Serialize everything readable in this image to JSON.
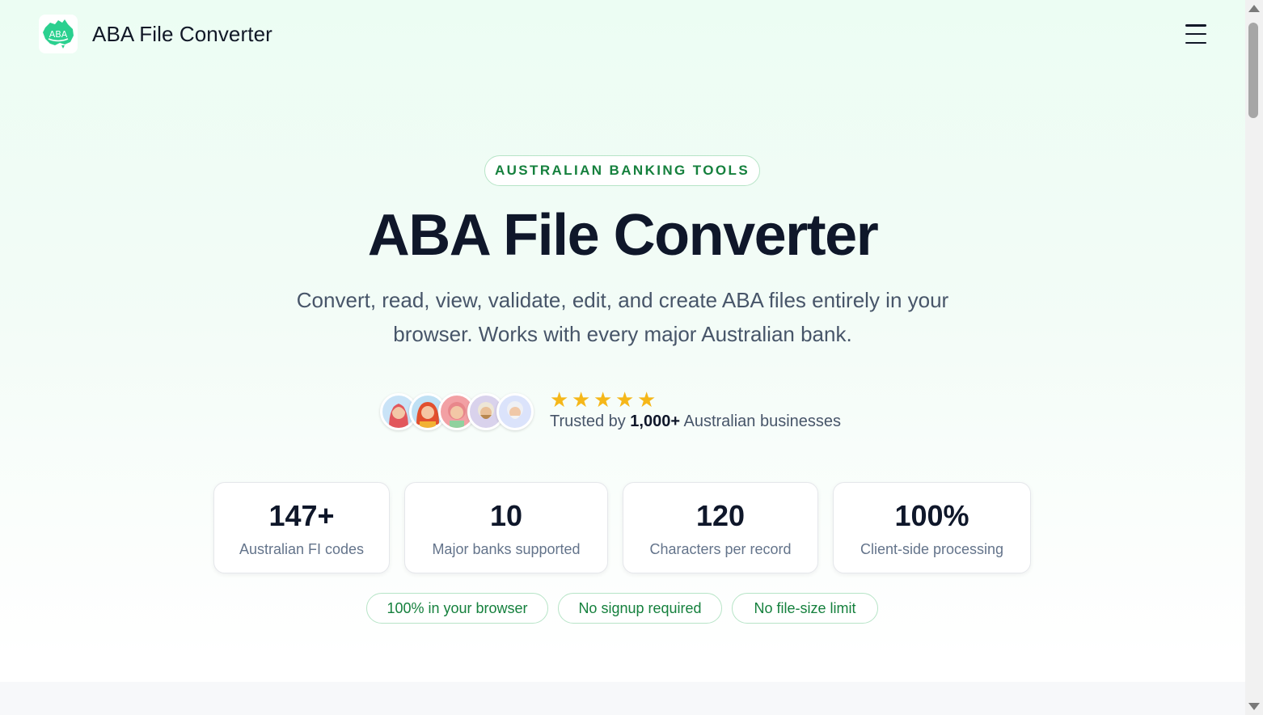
{
  "header": {
    "logo_text": "ABA",
    "brand": "ABA File Converter",
    "menu_icon": "hamburger-menu-icon"
  },
  "hero": {
    "eyebrow": "AUSTRALIAN BANKING TOOLS",
    "title": "ABA File Converter",
    "subtitle_line1": "Convert, read, view, validate, edit, and create ABA files entirely in your",
    "subtitle_line2": "browser. Works with every major Australian bank."
  },
  "trust": {
    "avatars": [
      "avatar-1",
      "avatar-2",
      "avatar-3",
      "avatar-4",
      "avatar-5"
    ],
    "rating": 5,
    "text_prefix": "Trusted by ",
    "text_bold": "1,000+",
    "text_suffix": " Australian businesses"
  },
  "stats": [
    {
      "value": "147+",
      "label": "Australian FI codes"
    },
    {
      "value": "10",
      "label": "Major banks supported"
    },
    {
      "value": "120",
      "label": "Characters per record"
    },
    {
      "value": "100%",
      "label": "Client-side processing"
    }
  ],
  "pills": [
    "100% in your browser",
    "No signup required",
    "No file-size limit"
  ],
  "colors": {
    "accent": "#15803d",
    "star": "#f5b719",
    "pill_border": "#b7e4c7"
  }
}
